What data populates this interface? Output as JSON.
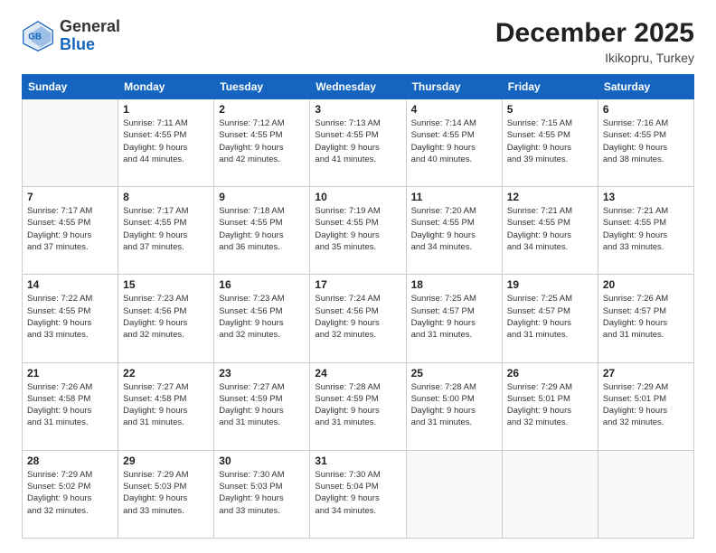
{
  "header": {
    "logo_line1": "General",
    "logo_line2": "Blue",
    "month": "December 2025",
    "location": "Ikikopru, Turkey"
  },
  "weekdays": [
    "Sunday",
    "Monday",
    "Tuesday",
    "Wednesday",
    "Thursday",
    "Friday",
    "Saturday"
  ],
  "weeks": [
    [
      {
        "day": "",
        "info": ""
      },
      {
        "day": "1",
        "info": "Sunrise: 7:11 AM\nSunset: 4:55 PM\nDaylight: 9 hours\nand 44 minutes."
      },
      {
        "day": "2",
        "info": "Sunrise: 7:12 AM\nSunset: 4:55 PM\nDaylight: 9 hours\nand 42 minutes."
      },
      {
        "day": "3",
        "info": "Sunrise: 7:13 AM\nSunset: 4:55 PM\nDaylight: 9 hours\nand 41 minutes."
      },
      {
        "day": "4",
        "info": "Sunrise: 7:14 AM\nSunset: 4:55 PM\nDaylight: 9 hours\nand 40 minutes."
      },
      {
        "day": "5",
        "info": "Sunrise: 7:15 AM\nSunset: 4:55 PM\nDaylight: 9 hours\nand 39 minutes."
      },
      {
        "day": "6",
        "info": "Sunrise: 7:16 AM\nSunset: 4:55 PM\nDaylight: 9 hours\nand 38 minutes."
      }
    ],
    [
      {
        "day": "7",
        "info": "Sunrise: 7:17 AM\nSunset: 4:55 PM\nDaylight: 9 hours\nand 37 minutes."
      },
      {
        "day": "8",
        "info": "Sunrise: 7:17 AM\nSunset: 4:55 PM\nDaylight: 9 hours\nand 37 minutes."
      },
      {
        "day": "9",
        "info": "Sunrise: 7:18 AM\nSunset: 4:55 PM\nDaylight: 9 hours\nand 36 minutes."
      },
      {
        "day": "10",
        "info": "Sunrise: 7:19 AM\nSunset: 4:55 PM\nDaylight: 9 hours\nand 35 minutes."
      },
      {
        "day": "11",
        "info": "Sunrise: 7:20 AM\nSunset: 4:55 PM\nDaylight: 9 hours\nand 34 minutes."
      },
      {
        "day": "12",
        "info": "Sunrise: 7:21 AM\nSunset: 4:55 PM\nDaylight: 9 hours\nand 34 minutes."
      },
      {
        "day": "13",
        "info": "Sunrise: 7:21 AM\nSunset: 4:55 PM\nDaylight: 9 hours\nand 33 minutes."
      }
    ],
    [
      {
        "day": "14",
        "info": "Sunrise: 7:22 AM\nSunset: 4:55 PM\nDaylight: 9 hours\nand 33 minutes."
      },
      {
        "day": "15",
        "info": "Sunrise: 7:23 AM\nSunset: 4:56 PM\nDaylight: 9 hours\nand 32 minutes."
      },
      {
        "day": "16",
        "info": "Sunrise: 7:23 AM\nSunset: 4:56 PM\nDaylight: 9 hours\nand 32 minutes."
      },
      {
        "day": "17",
        "info": "Sunrise: 7:24 AM\nSunset: 4:56 PM\nDaylight: 9 hours\nand 32 minutes."
      },
      {
        "day": "18",
        "info": "Sunrise: 7:25 AM\nSunset: 4:57 PM\nDaylight: 9 hours\nand 31 minutes."
      },
      {
        "day": "19",
        "info": "Sunrise: 7:25 AM\nSunset: 4:57 PM\nDaylight: 9 hours\nand 31 minutes."
      },
      {
        "day": "20",
        "info": "Sunrise: 7:26 AM\nSunset: 4:57 PM\nDaylight: 9 hours\nand 31 minutes."
      }
    ],
    [
      {
        "day": "21",
        "info": "Sunrise: 7:26 AM\nSunset: 4:58 PM\nDaylight: 9 hours\nand 31 minutes."
      },
      {
        "day": "22",
        "info": "Sunrise: 7:27 AM\nSunset: 4:58 PM\nDaylight: 9 hours\nand 31 minutes."
      },
      {
        "day": "23",
        "info": "Sunrise: 7:27 AM\nSunset: 4:59 PM\nDaylight: 9 hours\nand 31 minutes."
      },
      {
        "day": "24",
        "info": "Sunrise: 7:28 AM\nSunset: 4:59 PM\nDaylight: 9 hours\nand 31 minutes."
      },
      {
        "day": "25",
        "info": "Sunrise: 7:28 AM\nSunset: 5:00 PM\nDaylight: 9 hours\nand 31 minutes."
      },
      {
        "day": "26",
        "info": "Sunrise: 7:29 AM\nSunset: 5:01 PM\nDaylight: 9 hours\nand 32 minutes."
      },
      {
        "day": "27",
        "info": "Sunrise: 7:29 AM\nSunset: 5:01 PM\nDaylight: 9 hours\nand 32 minutes."
      }
    ],
    [
      {
        "day": "28",
        "info": "Sunrise: 7:29 AM\nSunset: 5:02 PM\nDaylight: 9 hours\nand 32 minutes."
      },
      {
        "day": "29",
        "info": "Sunrise: 7:29 AM\nSunset: 5:03 PM\nDaylight: 9 hours\nand 33 minutes."
      },
      {
        "day": "30",
        "info": "Sunrise: 7:30 AM\nSunset: 5:03 PM\nDaylight: 9 hours\nand 33 minutes."
      },
      {
        "day": "31",
        "info": "Sunrise: 7:30 AM\nSunset: 5:04 PM\nDaylight: 9 hours\nand 34 minutes."
      },
      {
        "day": "",
        "info": ""
      },
      {
        "day": "",
        "info": ""
      },
      {
        "day": "",
        "info": ""
      }
    ]
  ]
}
